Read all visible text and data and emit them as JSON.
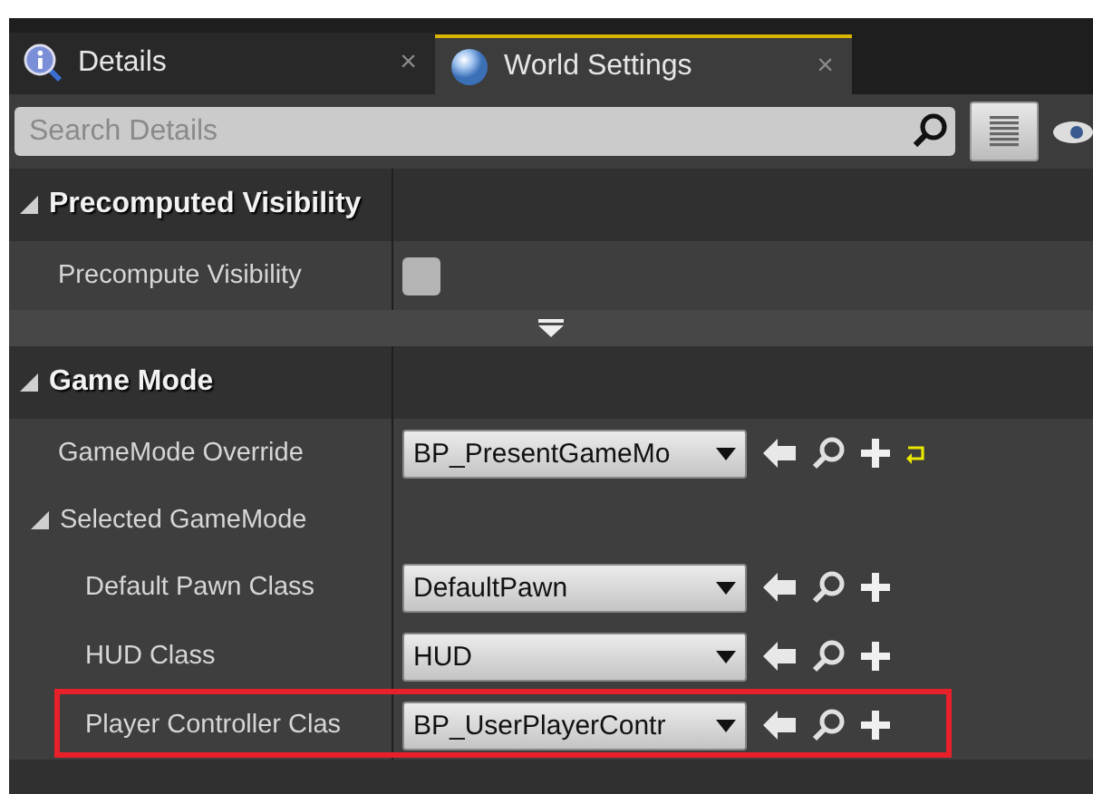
{
  "tabs": [
    {
      "label": "Details",
      "selected": false,
      "close": "×"
    },
    {
      "label": "World Settings",
      "selected": true,
      "close": "×"
    }
  ],
  "search": {
    "placeholder": "Search Details"
  },
  "sections": [
    {
      "title": "Precomputed Visibility",
      "expanded": true,
      "advanced_toggle": true,
      "properties": [
        {
          "kind": "checkbox",
          "label": "Precompute Visibility",
          "checked": false
        }
      ]
    },
    {
      "title": "Game Mode",
      "expanded": true,
      "advanced_toggle": false,
      "properties": [
        {
          "kind": "class",
          "label": "GameMode Override",
          "value": "BP_PresentGameMo",
          "resettable": true,
          "highlighted": false
        },
        {
          "kind": "group",
          "label": "Selected GameMode",
          "expanded": true,
          "children": [
            {
              "kind": "class",
              "label": "Default Pawn Class",
              "value": "DefaultPawn",
              "resettable": false,
              "highlighted": false
            },
            {
              "kind": "class",
              "label": "HUD Class",
              "value": "HUD",
              "resettable": false,
              "highlighted": false
            },
            {
              "kind": "class",
              "label": "Player Controller Clas",
              "value": "BP_UserPlayerContr",
              "resettable": false,
              "highlighted": true
            }
          ]
        }
      ]
    }
  ]
}
